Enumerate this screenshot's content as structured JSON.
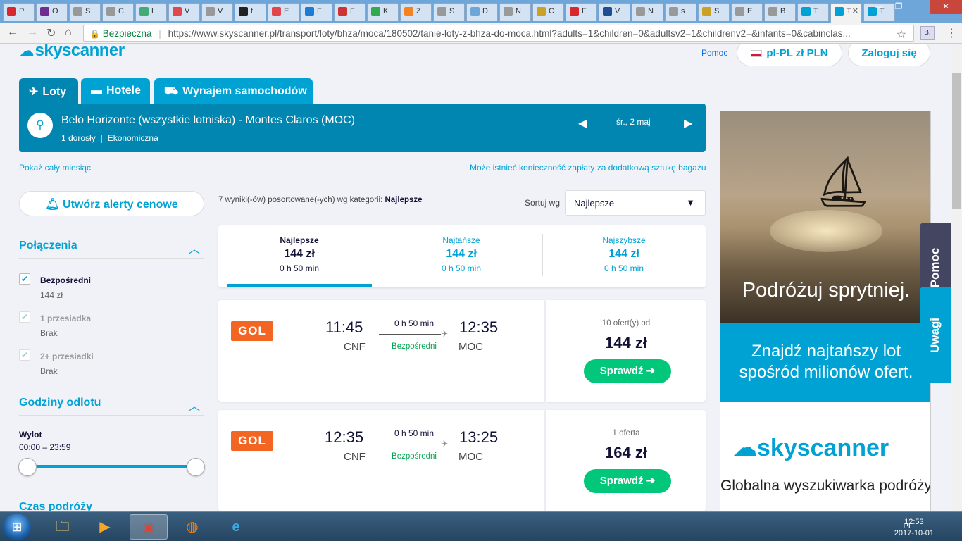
{
  "browser": {
    "tabs": [
      {
        "label": "P",
        "color": "#d9272e"
      },
      {
        "label": "O",
        "color": "#6f2c91"
      },
      {
        "label": "S",
        "color": "#999999"
      },
      {
        "label": "C",
        "color": "#999999"
      },
      {
        "label": "L",
        "color": "#4a7"
      },
      {
        "label": "V",
        "color": "#e0474c"
      },
      {
        "label": "V",
        "color": "#999999"
      },
      {
        "label": "t",
        "color": "#222222"
      },
      {
        "label": "E",
        "color": "#e0474c"
      },
      {
        "label": "F",
        "color": "#1d7bd4"
      },
      {
        "label": "F",
        "color": "#c33"
      },
      {
        "label": "K",
        "color": "#34a853"
      },
      {
        "label": "Z",
        "color": "#f58220"
      },
      {
        "label": "S",
        "color": "#999999"
      },
      {
        "label": "D",
        "color": "#6fa6d9"
      },
      {
        "label": "N",
        "color": "#999999"
      },
      {
        "label": "C",
        "color": "#c9a227"
      },
      {
        "label": "F",
        "color": "#d9272e"
      },
      {
        "label": "V",
        "color": "#1d4f91"
      },
      {
        "label": "N",
        "color": "#999999"
      },
      {
        "label": "s",
        "color": "#999999"
      },
      {
        "label": "S",
        "color": "#c9a227"
      },
      {
        "label": "E",
        "color": "#999999"
      },
      {
        "label": "B",
        "color": "#999999"
      },
      {
        "label": "T",
        "color": "#00a2d4"
      },
      {
        "label": "T",
        "color": "#00a2d4",
        "active": true
      },
      {
        "label": "T",
        "color": "#00a2d4"
      }
    ],
    "secure_label": "Bezpieczna",
    "url": "https://www.skyscanner.pl/transport/loty/bhza/moca/180502/tanie-loty-z-bhza-do-moca.html?adults=1&children=0&adultsv2=1&childrenv2=&infants=0&cabinclas...",
    "ext_label": "B."
  },
  "header": {
    "logo": "skyscanner",
    "help": "Pomoc",
    "locale": "pl-PL zł PLN",
    "login": "Zaloguj się"
  },
  "nav_tabs": [
    {
      "label": "Loty",
      "icon": "plane-icon",
      "glyph": "✈"
    },
    {
      "label": "Hotele",
      "icon": "bed-icon",
      "glyph": "🛏"
    },
    {
      "label": "Wynajem samochodów",
      "icon": "car-icon",
      "glyph": "🚘"
    }
  ],
  "search": {
    "route": "Belo Horizonte (wszystkie lotniska) - Montes Claros (MOC)",
    "passengers": "1 dorosły",
    "cabin": "Ekonomiczna",
    "date": "śr., 2 maj"
  },
  "links": {
    "month": "Pokaż cały miesiąc",
    "baggage": "Może istnieć konieczność zapłaty za dodatkową sztukę bagażu"
  },
  "filters": {
    "alert_button": "Utwórz alerty cenowe",
    "connections_title": "Połączenia",
    "connections": [
      {
        "label": "Bezpośredni",
        "sub": "144 zł",
        "checked": true
      },
      {
        "label": "1 przesiadka",
        "sub": "Brak",
        "checked": true
      },
      {
        "label": "2+ przesiadki",
        "sub": "Brak",
        "checked": true
      }
    ],
    "departure_title": "Godziny odlotu",
    "departure_label": "Wylot",
    "departure_range": "00:00 – 23:59",
    "duration_title": "Czas podróży"
  },
  "results": {
    "count_text": "7 wyniki(-ów) posortowane(-ych) wg kategorii:",
    "sort_category": "Najlepsze",
    "sort_label": "Sortuj wg",
    "sort_value": "Najlepsze"
  },
  "summary": [
    {
      "title": "Najlepsze",
      "price": "144 zł",
      "duration": "0 h 50 min"
    },
    {
      "title": "Najtańsze",
      "price": "144 zł",
      "duration": "0 h 50 min"
    },
    {
      "title": "Najszybsze",
      "price": "144 zł",
      "duration": "0 h 50 min"
    }
  ],
  "flights": [
    {
      "airline": "GOL",
      "dep_time": "11:45",
      "dep_code": "CNF",
      "duration": "0 h 50 min",
      "stops": "Bezpośredni",
      "arr_time": "12:35",
      "arr_code": "MOC",
      "offers": "10 ofert(y) od",
      "price": "144 zł",
      "button": "Sprawdź ➔"
    },
    {
      "airline": "GOL",
      "dep_time": "12:35",
      "dep_code": "CNF",
      "duration": "0 h 50 min",
      "stops": "Bezpośredni",
      "arr_time": "13:25",
      "arr_code": "MOC",
      "offers": "1 oferta",
      "price": "164 zł",
      "button": "Sprawdź ➔"
    }
  ],
  "ad": {
    "tagline": "Podróżuj sprytniej.",
    "headline": "Znajdź najtańszy lot spośród milionów ofert.",
    "logo": "skyscanner",
    "sub": "Globalna wyszukiwarka podróży"
  },
  "side_tabs": {
    "help": "Pomoc",
    "feedback": "Uwagi"
  },
  "taskbar": {
    "lang": "PL",
    "time": "12:53",
    "date": "2017-10-01"
  }
}
